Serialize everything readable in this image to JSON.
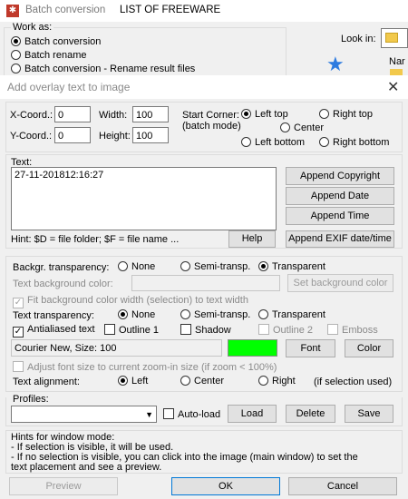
{
  "parent": {
    "app_title": "Batch conversion",
    "list_title": "LIST OF FREEWARE",
    "work_as_label": "Work as:",
    "work_as_options": [
      "Batch conversion",
      "Batch rename",
      "Batch conversion - Rename result files"
    ],
    "look_in_label": "Look in:",
    "name_col": "Nar"
  },
  "dialog": {
    "title": "Add overlay text to image",
    "xcoord_label": "X-Coord.:",
    "xcoord_value": "0",
    "ycoord_label": "Y-Coord.:",
    "ycoord_value": "0",
    "width_label": "Width:",
    "width_value": "100",
    "height_label": "Height:",
    "height_value": "100",
    "start_corner_label": "Start Corner:",
    "batch_mode_label": "(batch mode)",
    "corners": {
      "left_top": "Left top",
      "right_top": "Right top",
      "center": "Center",
      "left_bottom": "Left bottom",
      "right_bottom": "Right bottom"
    },
    "text_label": "Text:",
    "text_value": "27-11-201812:16:27",
    "append_buttons": [
      "Append Copyright",
      "Append Date",
      "Append Time"
    ],
    "hint_text": "Hint: $D = file folder; $F = file name ...",
    "help_button": "Help",
    "append_exif_button": "Append EXIF date/time",
    "bg_transparency_label": "Backgr. transparency:",
    "none_label": "None",
    "semi_label": "Semi-transp.",
    "transparent_label": "Transparent",
    "text_bg_color_label": "Text background color:",
    "set_bg_color_button": "Set background color",
    "fit_bg_label": "Fit background color width (selection) to text width",
    "text_transparency_label": "Text transparency:",
    "antialiased_label": "Antialiased text",
    "outline1_label": "Outline 1",
    "shadow_label": "Shadow",
    "outline2_label": "Outline 2",
    "emboss_label": "Emboss",
    "font_display": "Courier New, Size: 100",
    "text_color": "#00ff00",
    "font_button": "Font",
    "color_button": "Color",
    "adjust_font_label": "Adjust font size to current zoom-in size (if zoom < 100%)",
    "text_alignment_label": "Text alignment:",
    "align_left": "Left",
    "align_center": "Center",
    "align_right": "Right",
    "if_selection_used": "(if selection used)",
    "profiles_label": "Profiles:",
    "profile_value": "",
    "autoload_label": "Auto-load",
    "load_button": "Load",
    "delete_button": "Delete",
    "save_button": "Save",
    "hints_title": "Hints for window mode:",
    "hints_line1": "- If selection is visible, it will be used.",
    "hints_line2": "- If no selection is visible, you can click into the image (main window) to set the",
    "hints_line3": "text placement and see a preview.",
    "preview_button": "Preview",
    "ok_button": "OK",
    "cancel_button": "Cancel"
  }
}
